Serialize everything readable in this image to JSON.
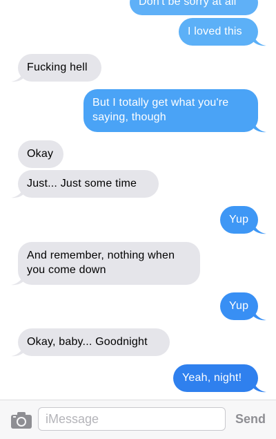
{
  "colors": {
    "incoming": "#e5e5ea",
    "outgoing": "#3b95f5",
    "outgoing_dark": "#2f80ee"
  },
  "messages": [
    {
      "direction": "sent",
      "text": "Don't be sorry at all"
    },
    {
      "direction": "sent",
      "text": "I loved this"
    },
    {
      "direction": "received",
      "text": "Fucking hell"
    },
    {
      "direction": "sent",
      "text": "But I totally get what you're saying, though"
    },
    {
      "direction": "received",
      "text": "Okay"
    },
    {
      "direction": "received",
      "text": "Just... Just some time"
    },
    {
      "direction": "sent",
      "text": "Yup"
    },
    {
      "direction": "received",
      "text": "And remember, nothing when you come down"
    },
    {
      "direction": "sent",
      "text": "Yup"
    },
    {
      "direction": "received",
      "text": "Okay, baby... Goodnight"
    },
    {
      "direction": "sent",
      "text": "Yeah, night!"
    }
  ],
  "composer": {
    "camera_icon": "camera-icon",
    "placeholder": "iMessage",
    "send_label": "Send"
  }
}
